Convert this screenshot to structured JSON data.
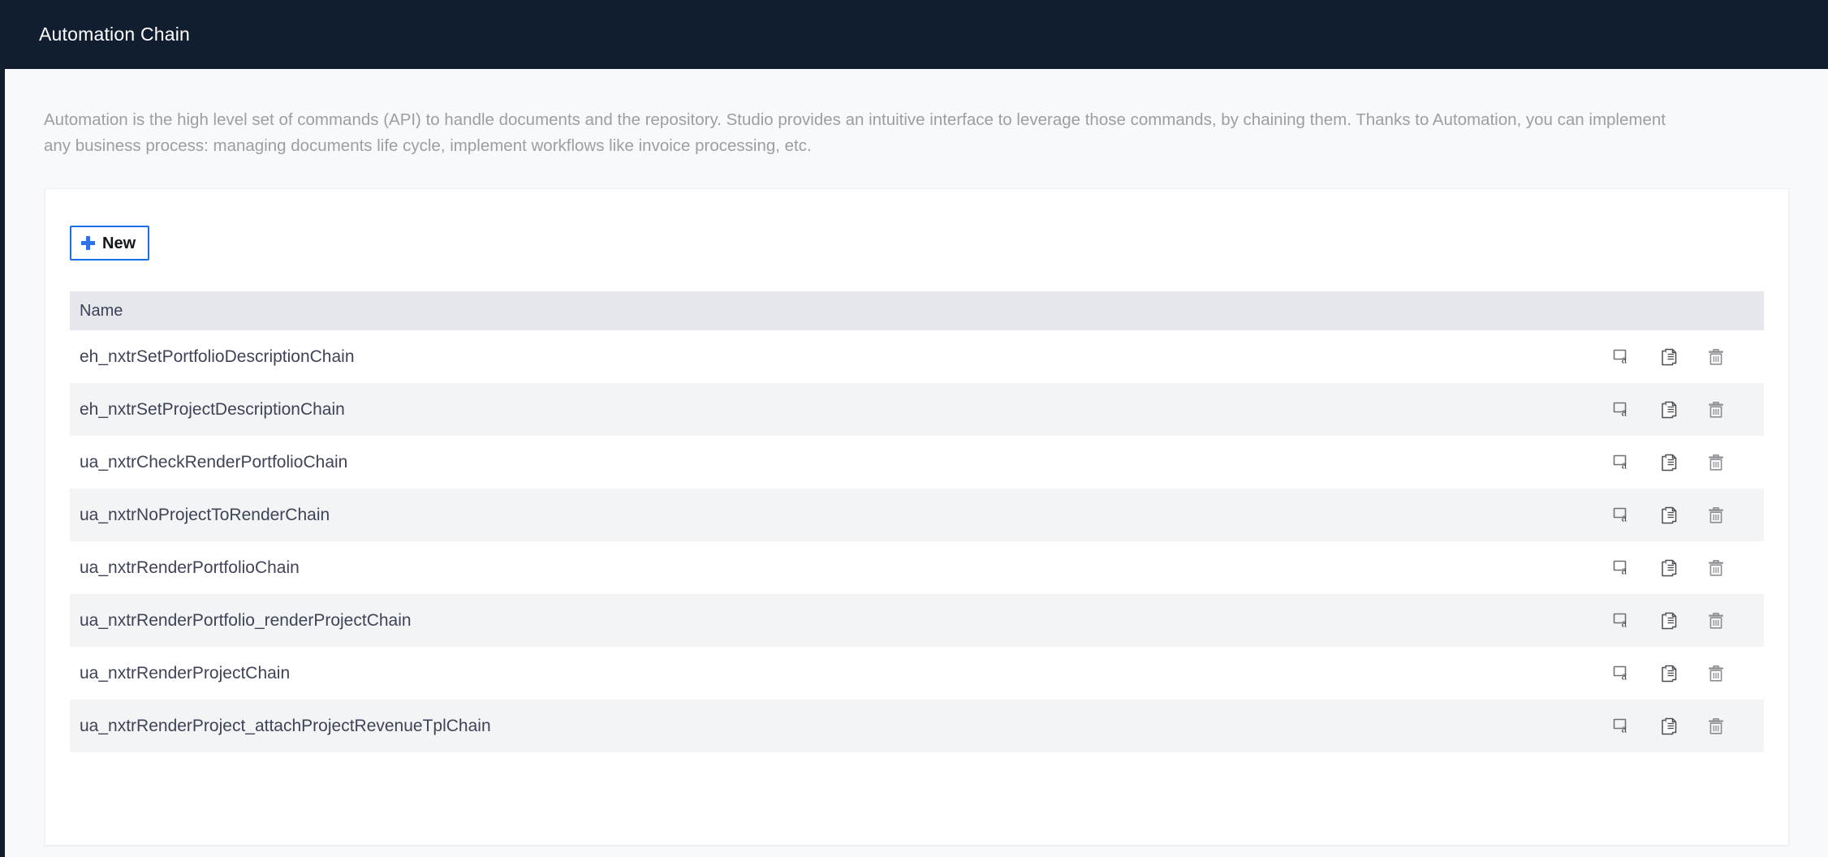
{
  "header": {
    "title": "Automation Chain"
  },
  "page": {
    "description": "Automation is the high level set of commands (API) to handle documents and the repository. Studio provides an intuitive interface to leverage those commands, by chaining them. Thanks to Automation, you can implement any business process: managing documents life cycle, implement workflows like invoice processing, etc."
  },
  "toolbar": {
    "new_label": "New",
    "new_icon": "plus-icon"
  },
  "table": {
    "columns": [
      "Name",
      ""
    ],
    "header_name": "Name",
    "row_actions": [
      {
        "name": "rename-icon",
        "title": "Rename"
      },
      {
        "name": "duplicate-icon",
        "title": "Duplicate"
      },
      {
        "name": "trash-icon",
        "title": "Delete"
      }
    ],
    "rows": [
      {
        "name": "eh_nxtrSetPortfolioDescriptionChain"
      },
      {
        "name": "eh_nxtrSetProjectDescriptionChain"
      },
      {
        "name": "ua_nxtrCheckRenderPortfolioChain"
      },
      {
        "name": "ua_nxtrNoProjectToRenderChain"
      },
      {
        "name": "ua_nxtrRenderPortfolioChain"
      },
      {
        "name": "ua_nxtrRenderPortfolio_renderProjectChain"
      },
      {
        "name": "ua_nxtrRenderProjectChain"
      },
      {
        "name": "ua_nxtrRenderProject_attachProjectRevenueTplChain"
      }
    ]
  },
  "colors": {
    "header_bg": "#111e2f",
    "page_bg": "#f8f9fa",
    "card_bg": "#ffffff",
    "accent_blue": "#2f72e8",
    "table_header_bg": "#e5e7ec",
    "row_alt_bg": "#f3f4f5",
    "text_muted": "#9b9ea3",
    "text_primary": "#3e4358"
  }
}
